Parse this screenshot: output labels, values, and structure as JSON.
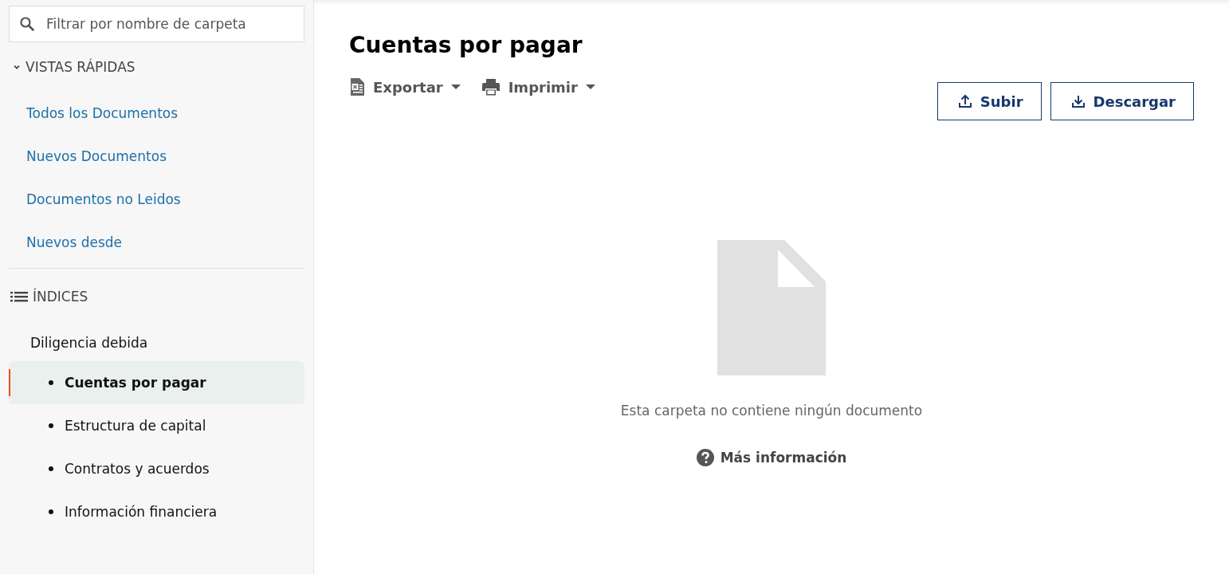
{
  "sidebar": {
    "search": {
      "placeholder": "Filtrar por nombre de carpeta"
    },
    "quick_views": {
      "title": "VISTAS RÁPIDAS",
      "expanded": true,
      "items": [
        {
          "label": "Todos los Documentos"
        },
        {
          "label": "Nuevos Documentos"
        },
        {
          "label": "Documentos no Leidos"
        },
        {
          "label": "Nuevos desde"
        }
      ]
    },
    "indices": {
      "title": "ÍNDICES",
      "items": [
        {
          "label": "Diligencia debida",
          "selected": false,
          "children": [
            {
              "label": "Cuentas por pagar",
              "selected": true
            },
            {
              "label": "Estructura de capital",
              "selected": false
            },
            {
              "label": "Contratos y acuerdos",
              "selected": false
            },
            {
              "label": "Información financiera",
              "selected": false
            }
          ]
        }
      ]
    }
  },
  "main": {
    "title": "Cuentas por pagar",
    "toolbar": [
      {
        "kind": "export",
        "label": "Exportar"
      },
      {
        "kind": "print",
        "label": "Imprimir"
      }
    ],
    "buttons": [
      {
        "kind": "upload",
        "label": "Subir"
      },
      {
        "kind": "download",
        "label": "Descargar"
      }
    ],
    "empty_state": {
      "message": "Esta carpeta no contiene ningún documento",
      "link": "Más información"
    }
  }
}
